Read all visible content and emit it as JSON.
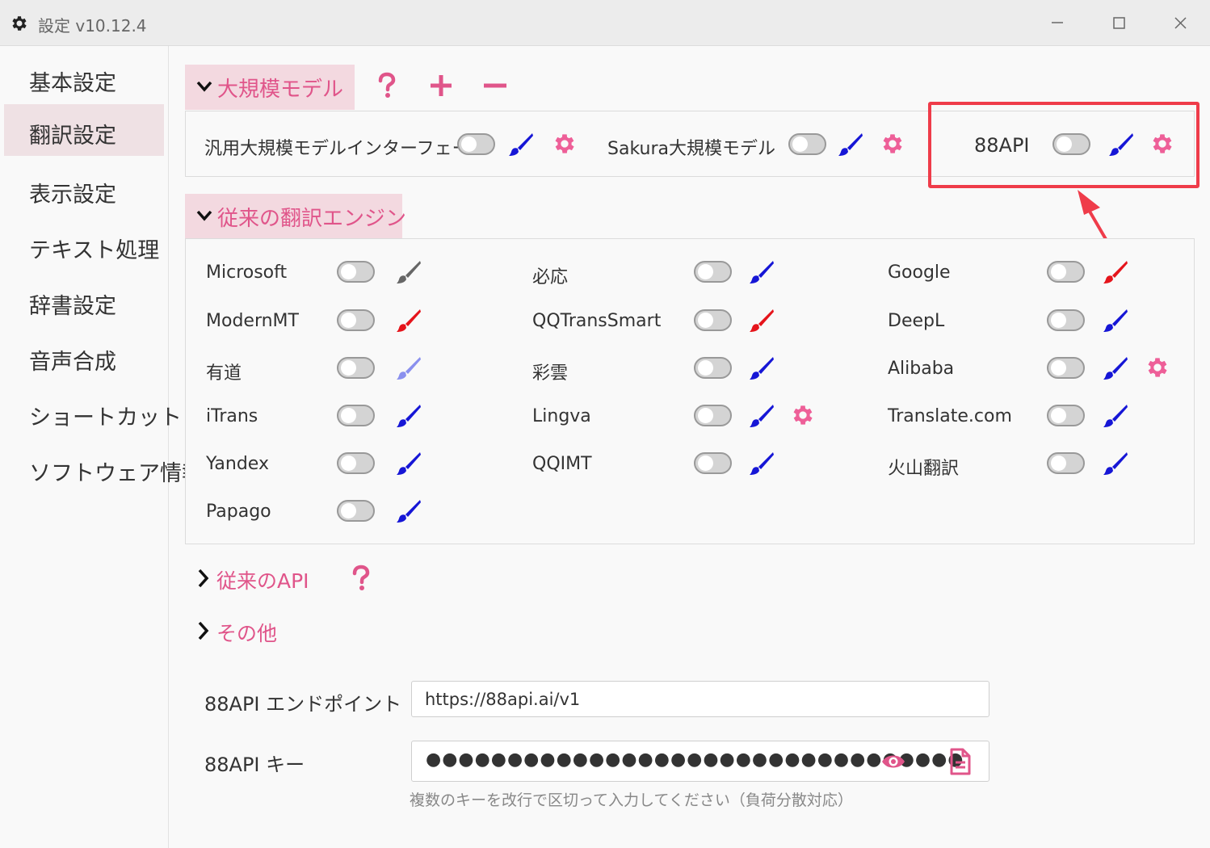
{
  "window": {
    "title": "設定 v10.12.4"
  },
  "sidebar": {
    "items": [
      {
        "label": "基本設定"
      },
      {
        "label": "翻訳設定"
      },
      {
        "label": "表示設定"
      },
      {
        "label": "テキスト処理"
      },
      {
        "label": "辞書設定"
      },
      {
        "label": "音声合成"
      },
      {
        "label": "ショートカット"
      },
      {
        "label": "ソフトウェア情報"
      }
    ],
    "selected": "翻訳設定"
  },
  "llm_section": {
    "title": "大規模モデル",
    "engines": [
      {
        "label": "汎用大規模モデルインターフェース",
        "enabled": false,
        "brush_color": "#1616d6",
        "has_settings": true
      },
      {
        "label": "Sakura大規模モデル",
        "enabled": false,
        "brush_color": "#1616d6",
        "has_settings": true
      },
      {
        "label": "88API",
        "enabled": false,
        "brush_color": "#1616d6",
        "has_settings": true
      }
    ]
  },
  "classic_section": {
    "title": "従来の翻訳エンジン",
    "engines": [
      {
        "label": "Microsoft",
        "enabled": false,
        "brush_color": "#666666",
        "has_settings": false
      },
      {
        "label": "必応",
        "enabled": false,
        "brush_color": "#1616d6",
        "has_settings": false
      },
      {
        "label": "Google",
        "enabled": false,
        "brush_color": "#e5141b",
        "has_settings": false
      },
      {
        "label": "ModernMT",
        "enabled": false,
        "brush_color": "#e5141b",
        "has_settings": false
      },
      {
        "label": "QQTransSmart",
        "enabled": false,
        "brush_color": "#e5141b",
        "has_settings": false
      },
      {
        "label": "DeepL",
        "enabled": false,
        "brush_color": "#1616d6",
        "has_settings": false
      },
      {
        "label": "有道",
        "enabled": false,
        "brush_color": "#8a90ee",
        "has_settings": false
      },
      {
        "label": "彩雲",
        "enabled": false,
        "brush_color": "#1616d6",
        "has_settings": false
      },
      {
        "label": "Alibaba",
        "enabled": false,
        "brush_color": "#1616d6",
        "has_settings": true
      },
      {
        "label": "iTrans",
        "enabled": false,
        "brush_color": "#1616d6",
        "has_settings": false
      },
      {
        "label": "Lingva",
        "enabled": false,
        "brush_color": "#1616d6",
        "has_settings": true
      },
      {
        "label": "Translate.com",
        "enabled": false,
        "brush_color": "#1616d6",
        "has_settings": false
      },
      {
        "label": "Yandex",
        "enabled": false,
        "brush_color": "#1616d6",
        "has_settings": false
      },
      {
        "label": "QQIMT",
        "enabled": false,
        "brush_color": "#1616d6",
        "has_settings": false
      },
      {
        "label": "火山翻訳",
        "enabled": false,
        "brush_color": "#1616d6",
        "has_settings": false
      },
      {
        "label": "Papago",
        "enabled": false,
        "brush_color": "#1616d6",
        "has_settings": false
      }
    ]
  },
  "collapsed_sections": {
    "classic_api": {
      "title": "従来のAPI"
    },
    "other": {
      "title": "その他"
    }
  },
  "form": {
    "endpoint": {
      "label": "88API エンドポイント",
      "value": "https://88api.ai/v1"
    },
    "key": {
      "label": "88API キー",
      "masked_value": "●●●●●●●●●●●●●●●●●●●●●●●●●●●●●●●●●",
      "hint": "複数のキーを改行で区切って入力してください（負荷分散対応）"
    }
  },
  "colors": {
    "accent": "#e0558a",
    "section_bg": "#f3d9e0",
    "highlight": "#ef3c4a"
  }
}
